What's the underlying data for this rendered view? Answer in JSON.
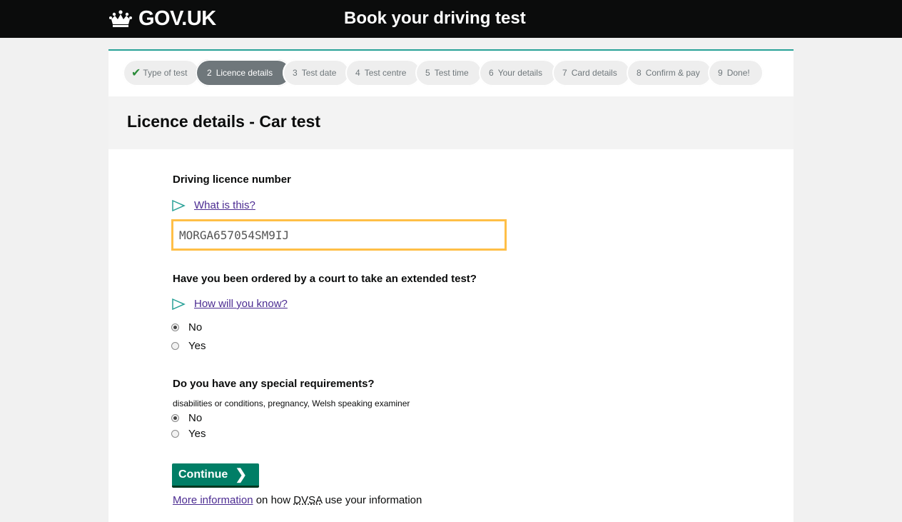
{
  "header": {
    "brand": "GOV.UK",
    "service_name": "Book your driving test"
  },
  "steps": [
    {
      "num": "",
      "label": "Type of test",
      "state": "done"
    },
    {
      "num": "2",
      "label": "Licence details",
      "state": "active"
    },
    {
      "num": "3",
      "label": "Test date",
      "state": "todo"
    },
    {
      "num": "4",
      "label": "Test centre",
      "state": "todo"
    },
    {
      "num": "5",
      "label": "Test time",
      "state": "todo"
    },
    {
      "num": "6",
      "label": "Your details",
      "state": "todo"
    },
    {
      "num": "7",
      "label": "Card details",
      "state": "todo"
    },
    {
      "num": "8",
      "label": "Confirm & pay",
      "state": "todo"
    },
    {
      "num": "9",
      "label": "Done!",
      "state": "todo"
    }
  ],
  "page": {
    "title": "Licence details - Car test"
  },
  "licence": {
    "label": "Driving licence number",
    "help_link": "What is this?",
    "value": "MORGA657054SM9IJ"
  },
  "extended_test": {
    "question": "Have you been ordered by a court to take an extended test?",
    "help_link": "How will you know?",
    "options": [
      "No",
      "Yes"
    ],
    "selected": "No"
  },
  "special_requirements": {
    "question": "Do you have any special requirements?",
    "hint": "disabilities or conditions, pregnancy, Welsh speaking examiner",
    "options": [
      "No",
      "Yes"
    ],
    "selected": "No"
  },
  "continue_label": "Continue",
  "footer_info": {
    "link": "More information",
    "text_1": " on how ",
    "abbr": "DVSA",
    "text_2": " use your information"
  },
  "colors": {
    "header_bg": "#0b0c0c",
    "accent_teal": "#28a197",
    "button_green": "#007e66",
    "focus_yellow": "#ffbf47",
    "link_purple": "#4c2c92"
  }
}
